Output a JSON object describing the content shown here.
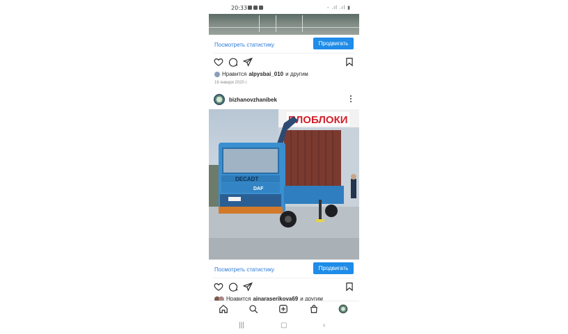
{
  "status_bar": {
    "time": "20:33"
  },
  "posts": [
    {
      "stats_link": "Посмотреть статистику",
      "promote_button": "Продвигать",
      "likes": {
        "prefix": "Нравится",
        "user": "alpysbai_010",
        "suffix": "и другим"
      },
      "date": "16 января 2020 г."
    },
    {
      "username": "bizhanovzhanibek",
      "image": {
        "sign_text": "ПЛОБЛОКИ",
        "cab_text": "DECADT",
        "brand": "DAF"
      },
      "stats_link": "Посмотреть статистику",
      "promote_button": "Продвигать",
      "likes": {
        "prefix": "Нравится",
        "user": "ainaraserikova69",
        "suffix": "и другим"
      }
    }
  ],
  "bottom_nav": [
    "home-icon",
    "search-icon",
    "add-post-icon",
    "shop-icon",
    "profile-icon"
  ],
  "colors": {
    "accent": "#1e8ce8",
    "link": "#2a7ad8",
    "truck": "#3a8fd0"
  }
}
